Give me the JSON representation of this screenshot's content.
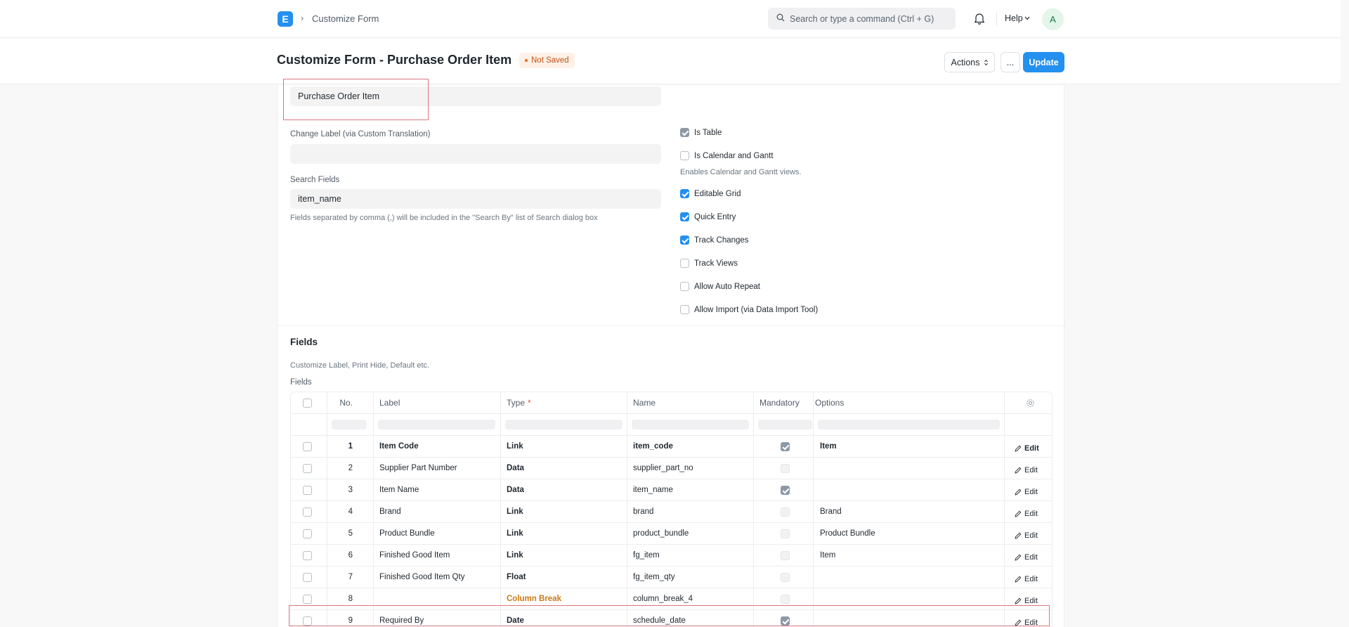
{
  "navbar": {
    "logo_letter": "E",
    "breadcrumb_sep": "›",
    "breadcrumb": "Customize Form",
    "search_placeholder": "Search or type a command (Ctrl + G)",
    "help_label": "Help",
    "avatar_letter": "A"
  },
  "page": {
    "title": "Customize Form - Purchase Order Item",
    "status": "Not Saved",
    "actions_label": "Actions",
    "more_label": "...",
    "update_label": "Update"
  },
  "form": {
    "doctype_value": "Purchase Order Item",
    "change_label_label": "Change Label (via Custom Translation)",
    "change_label_value": "",
    "search_fields_label": "Search Fields",
    "search_fields_value": "item_name",
    "search_fields_help": "Fields separated by comma (,) will be included in the \"Search By\" list of Search dialog box",
    "checkboxes": [
      {
        "label": "Is Table",
        "checked": true,
        "style": "grey"
      },
      {
        "label": "Is Calendar and Gantt",
        "checked": false
      },
      {
        "label": "Editable Grid",
        "checked": true
      },
      {
        "label": "Quick Entry",
        "checked": true
      },
      {
        "label": "Track Changes",
        "checked": true
      },
      {
        "label": "Track Views",
        "checked": false
      },
      {
        "label": "Allow Auto Repeat",
        "checked": false
      },
      {
        "label": "Allow Import (via Data Import Tool)",
        "checked": false
      }
    ],
    "calendar_help": "Enables Calendar and Gantt views."
  },
  "fields_section": {
    "title": "Fields",
    "help": "Customize Label, Print Hide, Default etc.",
    "table_label": "Fields",
    "columns": {
      "no": "No.",
      "label": "Label",
      "type": "Type",
      "required_mark": "*",
      "name": "Name",
      "mandatory": "Mandatory",
      "options": "Options"
    },
    "edit_label": "Edit",
    "rows": [
      {
        "no": "1",
        "label": "Item Code",
        "type": "Link",
        "name": "item_code",
        "mandatory": true,
        "options": "Item"
      },
      {
        "no": "2",
        "label": "Supplier Part Number",
        "type": "Data",
        "name": "supplier_part_no",
        "mandatory": false,
        "options": ""
      },
      {
        "no": "3",
        "label": "Item Name",
        "type": "Data",
        "name": "item_name",
        "mandatory": true,
        "options": ""
      },
      {
        "no": "4",
        "label": "Brand",
        "type": "Link",
        "name": "brand",
        "mandatory": false,
        "options": "Brand"
      },
      {
        "no": "5",
        "label": "Product Bundle",
        "type": "Link",
        "name": "product_bundle",
        "mandatory": false,
        "options": "Product Bundle"
      },
      {
        "no": "6",
        "label": "Finished Good Item",
        "type": "Link",
        "name": "fg_item",
        "mandatory": false,
        "options": "Item"
      },
      {
        "no": "7",
        "label": "Finished Good Item Qty",
        "type": "Float",
        "name": "fg_item_qty",
        "mandatory": false,
        "options": ""
      },
      {
        "no": "8",
        "label": "",
        "type": "Column Break",
        "name": "column_break_4",
        "mandatory": false,
        "options": ""
      },
      {
        "no": "9",
        "label": "Required By",
        "type": "Date",
        "name": "schedule_date",
        "mandatory": true,
        "options": ""
      }
    ]
  }
}
